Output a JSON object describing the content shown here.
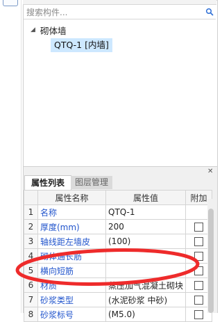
{
  "search": {
    "placeholder": "搜索构件..."
  },
  "tree": {
    "root": "砌体墙",
    "child": "QTQ-1 [内墙]"
  },
  "props": {
    "tabs": [
      "属性列表",
      "图层管理"
    ],
    "headers": {
      "name": "属性名称",
      "value": "属性值",
      "extra": "附加"
    },
    "rows": [
      {
        "num": "1",
        "name": "名称",
        "value": "QTQ-1",
        "checkbox": false
      },
      {
        "num": "2",
        "name": "厚度(mm)",
        "value": "200",
        "checkbox": true
      },
      {
        "num": "3",
        "name": "轴线距左墙皮",
        "value": "(100)",
        "checkbox": true
      },
      {
        "num": "4",
        "name": "砌体通长筋",
        "value": "",
        "checkbox": true
      },
      {
        "num": "5",
        "name": "横向短筋",
        "value": "",
        "checkbox": true
      },
      {
        "num": "6",
        "name": "材质",
        "value": "蒸压加气混凝土砌块",
        "checkbox": true
      },
      {
        "num": "7",
        "name": "砂浆类型",
        "value": "(水泥砂浆 中砂)",
        "checkbox": true
      },
      {
        "num": "8",
        "name": "砂浆标号",
        "value": "(M5.0)",
        "checkbox": true
      }
    ]
  },
  "annotation": {
    "color": "#ee2b2b"
  }
}
